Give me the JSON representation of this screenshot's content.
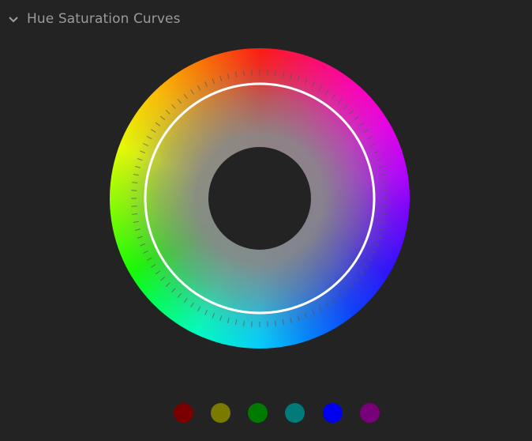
{
  "panel": {
    "title": "Hue Saturation Curves",
    "collapse_icon": "chevron-down-icon"
  },
  "wheel": {
    "name": "hue-saturation-wheel",
    "ring_color": "#ffffff",
    "tick_color": "#555555"
  },
  "swatches": [
    {
      "name": "red",
      "color": "#7a0000"
    },
    {
      "name": "yellow",
      "color": "#7a7a00"
    },
    {
      "name": "green",
      "color": "#007a00"
    },
    {
      "name": "cyan",
      "color": "#007a7a"
    },
    {
      "name": "blue",
      "color": "#0000f0"
    },
    {
      "name": "magenta",
      "color": "#7a007a"
    }
  ]
}
